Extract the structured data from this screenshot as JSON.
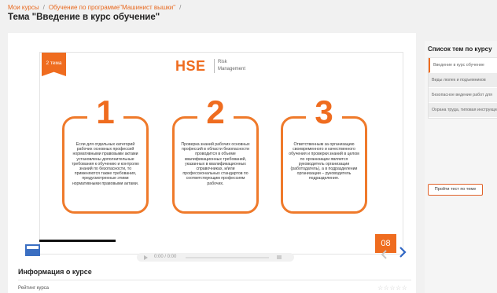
{
  "breadcrumb": {
    "items": [
      "Мои курсы",
      "Обучение по программе\"Машинист вышки\""
    ]
  },
  "page": {
    "title": "Тема \"Введение в курс обучение\""
  },
  "slide": {
    "tag": "2 тема",
    "logo": "HSE",
    "logo_sub": [
      "Risk",
      "Management"
    ],
    "cards": [
      {
        "number": "1",
        "text": "Если для отдельных категорий рабочих основных профессий нормативными правовыми актами установлены дополнительные требования к обучению и контролю знаний по безопасности, то применяются также требования, предусмотренные этими нормативными правовыми актами."
      },
      {
        "number": "2",
        "text": "Проверка знаний рабочих основных профессий в области безопасности проводится в объеме квалификационных требований, указанных в квалификационных справочниках, и/или профессиональных стандартов по соответствующим профессиям рабочих."
      },
      {
        "number": "3",
        "text": "Ответственным за организацию своевременного и качественного обучения и проверки знаний в целом по организации является руководитель организации (работодатель), а в подразделении организации – руководитель подразделения."
      }
    ],
    "slide_number": "08"
  },
  "audio": {
    "time": "0:00 / 0:00"
  },
  "info": {
    "title": "Информация о курсе",
    "rating_label": "Рейтинг курса",
    "stars": "☆☆☆☆☆"
  },
  "sidebar": {
    "title": "Список тем по курсу",
    "items": [
      "Введение в курс обучение",
      "Виды люлек и подъемников",
      "Безопасное ведение работ для",
      "Охрана труда, типовая инструкция"
    ],
    "test_button": "Пройти тест по теме"
  },
  "colors": {
    "accent": "#ef6c1f",
    "blue": "#3b6fc2"
  }
}
